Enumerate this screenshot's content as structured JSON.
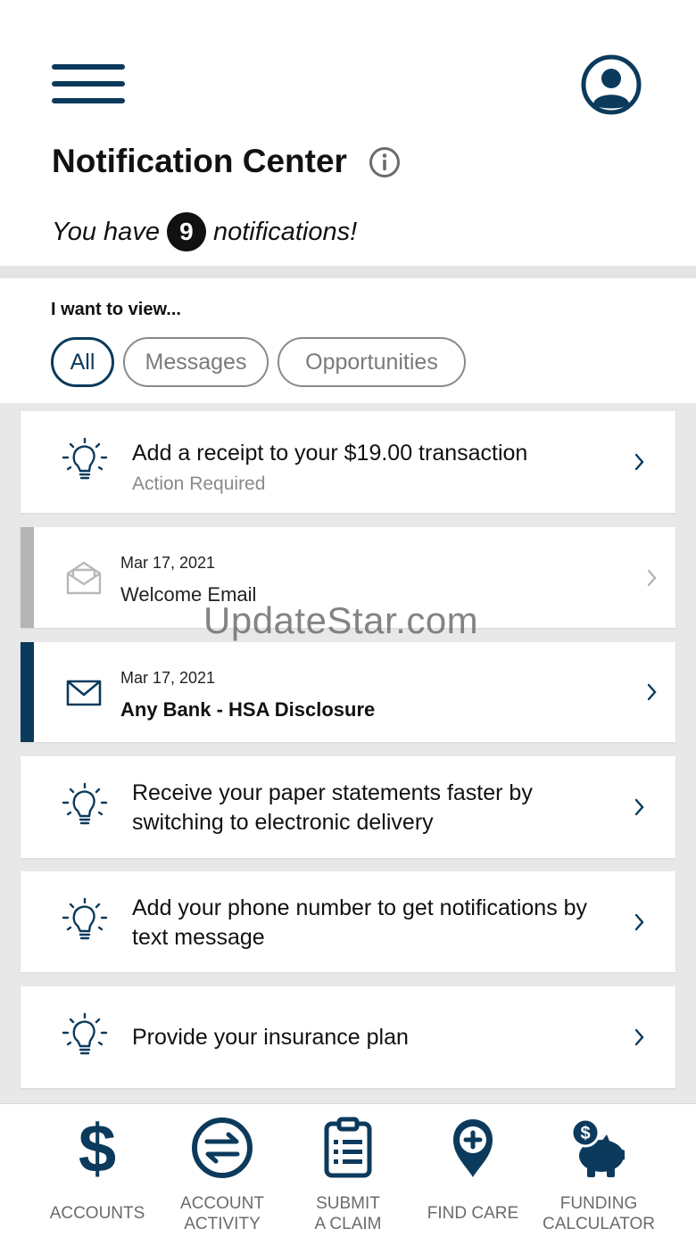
{
  "header": {
    "title": "Notification Center",
    "notif_prefix": "You have",
    "notif_count": "9",
    "notif_suffix": "notifications!"
  },
  "filter": {
    "heading": "I want to view...",
    "chips": [
      "All",
      "Messages",
      "Opportunities"
    ],
    "selected": "All"
  },
  "notifications": [
    {
      "type": "opportunity",
      "title": "Add a receipt to your $19.00 transaction",
      "subtitle": "Action Required"
    },
    {
      "type": "message",
      "read": true,
      "date": "Mar 17, 2021",
      "title": "Welcome Email"
    },
    {
      "type": "message",
      "read": false,
      "date": "Mar 17, 2021",
      "title": "Any Bank - HSA Disclosure"
    },
    {
      "type": "opportunity",
      "title_line1": "Receive your paper statements faster by",
      "title_line2": "switching to electronic delivery"
    },
    {
      "type": "opportunity",
      "title_line1": "Add your phone number to get notifications by",
      "title_line2": "text message"
    },
    {
      "type": "opportunity",
      "title": "Provide your insurance plan"
    }
  ],
  "watermark": "UpdateStar.com",
  "bottom_nav": [
    {
      "icon": "dollar-icon",
      "line1": "ACCOUNTS",
      "line2": ""
    },
    {
      "icon": "exchange-arrows-icon",
      "line1": "ACCOUNT",
      "line2": "ACTIVITY"
    },
    {
      "icon": "clipboard-icon",
      "line1": "SUBMIT",
      "line2": "A CLAIM"
    },
    {
      "icon": "map-pin-plus-icon",
      "line1": "FIND CARE",
      "line2": ""
    },
    {
      "icon": "piggy-bank-icon",
      "line1": "FUNDING",
      "line2": "CALCULATOR"
    }
  ],
  "colors": {
    "brand": "#0b3a5c",
    "unread_accent": "#0b3a5c",
    "read_accent": "#b5b5b5",
    "list_background": "#e8e8e8"
  }
}
